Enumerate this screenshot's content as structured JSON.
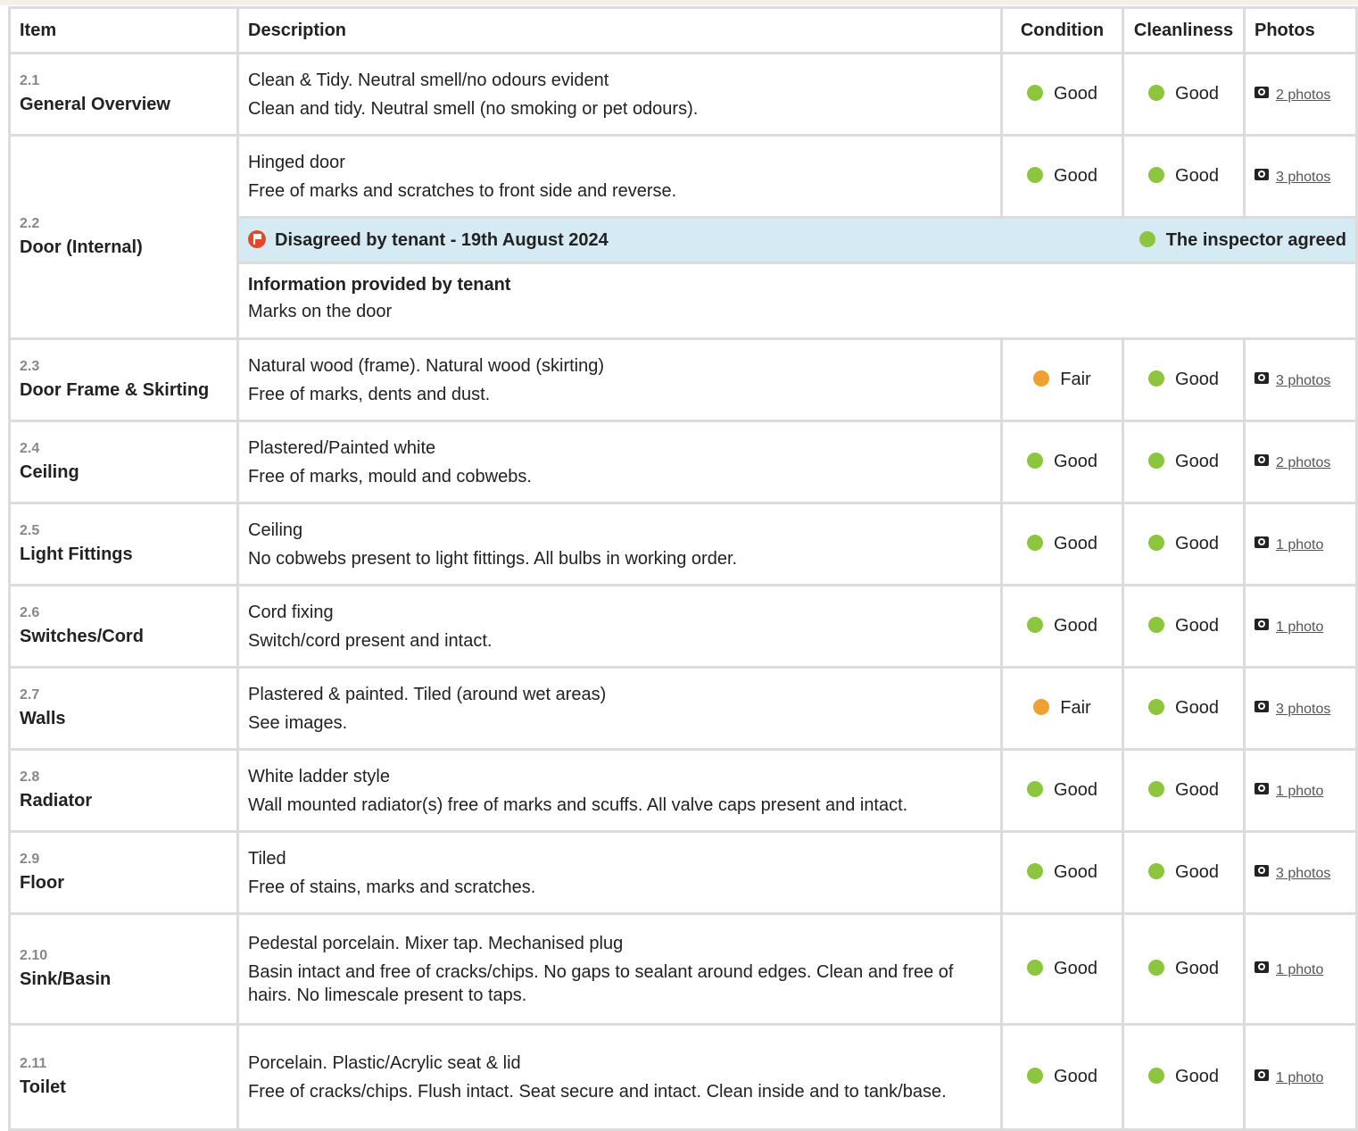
{
  "headers": {
    "item": "Item",
    "description": "Description",
    "condition": "Condition",
    "cleanliness": "Cleanliness",
    "photos": "Photos"
  },
  "colors": {
    "good": "#8cc63f",
    "fair": "#f0a030",
    "dispute_bg": "#d6eaf4",
    "flag": "#e24a2c"
  },
  "rows": [
    {
      "num": "2.1",
      "name": "General Overview",
      "desc1": "Clean & Tidy. Neutral smell/no odours evident",
      "desc2": "Clean and tidy. Neutral smell (no smoking or pet odours).",
      "condition": "Good",
      "cleanliness": "Good",
      "photos": "2 photos"
    },
    {
      "num": "2.2",
      "name": "Door (Internal)",
      "desc1": "Hinged door",
      "desc2": "Free of marks and scratches to front side and reverse.",
      "condition": "Good",
      "cleanliness": "Good",
      "photos": "3 photos",
      "dispute": {
        "label": "Disagreed by tenant - 19th August 2024",
        "outcome": "The inspector agreed",
        "info_title": "Information provided by tenant",
        "info_text": "Marks on the door"
      }
    },
    {
      "num": "2.3",
      "name": "Door Frame & Skirting",
      "desc1": "Natural wood (frame). Natural wood (skirting)",
      "desc2": "Free of marks, dents and dust.",
      "condition": "Fair",
      "cleanliness": "Good",
      "photos": "3 photos"
    },
    {
      "num": "2.4",
      "name": "Ceiling",
      "desc1": "Plastered/Painted white",
      "desc2": "Free of marks, mould and cobwebs.",
      "condition": "Good",
      "cleanliness": "Good",
      "photos": "2 photos"
    },
    {
      "num": "2.5",
      "name": "Light Fittings",
      "desc1": "Ceiling",
      "desc2": "No cobwebs present to light fittings. All bulbs in working order.",
      "condition": "Good",
      "cleanliness": "Good",
      "photos": "1 photo"
    },
    {
      "num": "2.6",
      "name": "Switches/Cord",
      "desc1": "Cord fixing",
      "desc2": "Switch/cord present and intact.",
      "condition": "Good",
      "cleanliness": "Good",
      "photos": "1 photo"
    },
    {
      "num": "2.7",
      "name": "Walls",
      "desc1": "Plastered & painted. Tiled (around wet areas)",
      "desc2": "See images.",
      "condition": "Fair",
      "cleanliness": "Good",
      "photos": "3 photos"
    },
    {
      "num": "2.8",
      "name": "Radiator",
      "desc1": "White ladder style",
      "desc2": "Wall mounted radiator(s) free of marks and scuffs. All valve caps present and intact.",
      "condition": "Good",
      "cleanliness": "Good",
      "photos": "1 photo"
    },
    {
      "num": "2.9",
      "name": "Floor",
      "desc1": "Tiled",
      "desc2": "Free of stains, marks and scratches.",
      "condition": "Good",
      "cleanliness": "Good",
      "photos": "3 photos"
    },
    {
      "num": "2.10",
      "name": "Sink/Basin",
      "desc1": "Pedestal porcelain. Mixer tap. Mechanised plug",
      "desc2": "Basin intact and free of cracks/chips. No gaps to sealant around edges. Clean and free of hairs. No limescale present to taps.",
      "condition": "Good",
      "cleanliness": "Good",
      "photos": "1 photo"
    },
    {
      "num": "2.11",
      "name": "Toilet",
      "desc1": "Porcelain. Plastic/Acrylic seat & lid",
      "desc2": "Free of cracks/chips. Flush intact. Seat secure and intact. Clean inside and to tank/base.",
      "condition": "Good",
      "cleanliness": "Good",
      "photos": "1 photo"
    }
  ]
}
